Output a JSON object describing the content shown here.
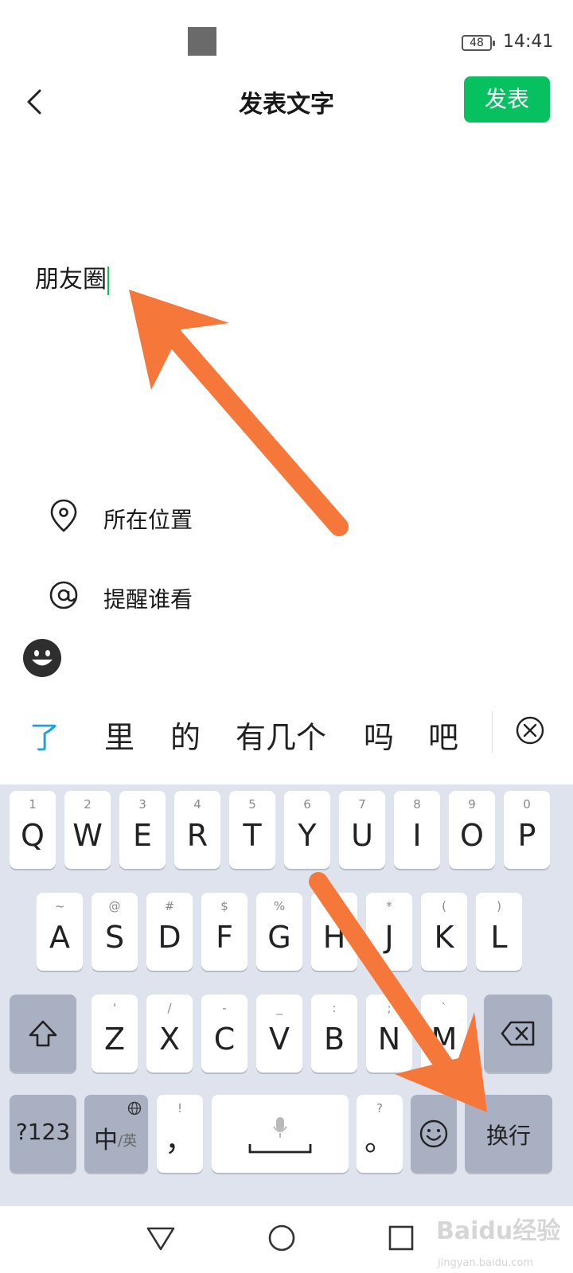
{
  "status_bar": {
    "battery": "48",
    "time": "14:41"
  },
  "header": {
    "title": "发表文字",
    "publish_label": "发表"
  },
  "editor": {
    "text": "朋友圈"
  },
  "options": [
    {
      "label": "所在位置",
      "icon": "location-pin-icon"
    },
    {
      "label": "提醒谁看",
      "icon": "at-icon"
    }
  ],
  "emoji_button": {
    "icon": "smiley-icon"
  },
  "candidates": [
    "了",
    "里",
    "的",
    "有几个",
    "吗",
    "吧"
  ],
  "keyboard": {
    "row1": [
      {
        "hint": "1",
        "key": "Q"
      },
      {
        "hint": "2",
        "key": "W"
      },
      {
        "hint": "3",
        "key": "E"
      },
      {
        "hint": "4",
        "key": "R"
      },
      {
        "hint": "5",
        "key": "T"
      },
      {
        "hint": "6",
        "key": "Y"
      },
      {
        "hint": "7",
        "key": "U"
      },
      {
        "hint": "8",
        "key": "I"
      },
      {
        "hint": "9",
        "key": "O"
      },
      {
        "hint": "0",
        "key": "P"
      }
    ],
    "row2": [
      {
        "hint": "~",
        "key": "A"
      },
      {
        "hint": "@",
        "key": "S"
      },
      {
        "hint": "#",
        "key": "D"
      },
      {
        "hint": "$",
        "key": "F"
      },
      {
        "hint": "%",
        "key": "G"
      },
      {
        "hint": "&",
        "key": "H"
      },
      {
        "hint": "*",
        "key": "J"
      },
      {
        "hint": "(",
        "key": "K"
      },
      {
        "hint": ")",
        "key": "L"
      }
    ],
    "row3": [
      {
        "hint": "'",
        "key": "Z"
      },
      {
        "hint": "/",
        "key": "X"
      },
      {
        "hint": "-",
        "key": "C"
      },
      {
        "hint": "_",
        "key": "V"
      },
      {
        "hint": ":",
        "key": "B"
      },
      {
        "hint": ";",
        "key": "N"
      },
      {
        "hint": "`",
        "key": "M"
      }
    ],
    "symbols_label": "?123",
    "lang_label_main": "中",
    "lang_label_sub": "/英",
    "comma_hint": "!",
    "comma_key": "，",
    "period_hint": "?",
    "period_key": "。",
    "enter_label": "换行"
  },
  "watermark": {
    "main": "Baidu经验",
    "sub": "jingyan.baidu.com"
  },
  "colors": {
    "accent_green": "#07c160",
    "arrow_orange": "#f5773a",
    "candidate_blue": "#1aa3e8"
  }
}
